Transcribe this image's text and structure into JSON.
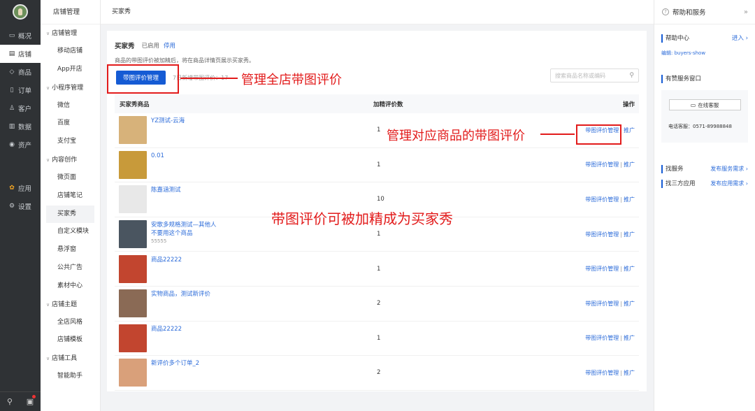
{
  "rail": {
    "items": [
      {
        "icon": "▭",
        "label": "概况"
      },
      {
        "icon": "▤",
        "label": "店铺"
      },
      {
        "icon": "◇",
        "label": "商品"
      },
      {
        "icon": "▯",
        "label": "订单"
      },
      {
        "icon": "♙",
        "label": "客户"
      },
      {
        "icon": "▥",
        "label": "数据"
      },
      {
        "icon": "◉",
        "label": "资产"
      }
    ],
    "apps": {
      "icon": "✿",
      "label": "应用"
    },
    "settings": {
      "icon": "⚙",
      "label": "设置"
    },
    "search_icon": "⚲",
    "chat_icon": "▣"
  },
  "subnav": {
    "header": "店铺管理",
    "groups": [
      {
        "label": "店铺管理",
        "items": [
          "移动店铺",
          "App开店"
        ]
      },
      {
        "label": "小程序管理",
        "items": [
          "微信",
          "百度",
          "支付宝"
        ]
      },
      {
        "label": "内容创作",
        "items": [
          "微页面",
          "店铺笔记",
          "买家秀",
          "自定义模块",
          "悬浮窗",
          "公共广告",
          "素材中心"
        ]
      },
      {
        "label": "店铺主题",
        "items": [
          "全店风格",
          "店铺模板"
        ]
      },
      {
        "label": "店铺工具",
        "items": [
          "智能助手"
        ]
      }
    ]
  },
  "topbar": {
    "title": "买家秀"
  },
  "main": {
    "title": "买家秀",
    "status": "已启用",
    "disable_label": "停用",
    "description": "商品的带图评价被加精后，将在商品详情页展示买家秀。",
    "manage_button": "带图评价管理",
    "hint": "7日新增带图评价：17",
    "search_placeholder": "搜索商品名称或编码",
    "search_icon": "⚲",
    "columns": {
      "product": "买家秀商品",
      "count": "加精评价数",
      "action": "操作"
    },
    "rows": [
      {
        "name": "YZ测试-云海",
        "sub": "",
        "count": "1",
        "thumb": "#d7b27a"
      },
      {
        "name": "0.01",
        "sub": "",
        "count": "1",
        "thumb": "#c89a3a"
      },
      {
        "name": "陈嘉涵测试",
        "sub": "",
        "count": "10",
        "thumb": "#e8e8e8"
      },
      {
        "name": "安歌多规格测试—其他人不要用这个商品",
        "sub": "55555",
        "count": "1",
        "thumb": "#4a5560"
      },
      {
        "name": "商品22222",
        "sub": "",
        "count": "1",
        "thumb": "#c2452f"
      },
      {
        "name": "实物商品，测试新评价",
        "sub": "",
        "count": "2",
        "thumb": "#8a6a55"
      },
      {
        "name": "商品22222",
        "sub": "",
        "count": "1",
        "thumb": "#c2452f"
      },
      {
        "name": "新评价多个订单_2",
        "sub": "",
        "count": "2",
        "thumb": "#d9a07a"
      }
    ],
    "action_manage": "带图评价管理",
    "action_promote": "推广",
    "action_sep": "|"
  },
  "help": {
    "title": "帮助和服务",
    "collapse_icon": "»",
    "help_center": "帮助中心",
    "enter": "进入 ›",
    "edit_label": "编辑: buyers-show",
    "service_window": "有赞服务窗口",
    "online_cs": "在线客服",
    "phone": "电话客服：0571-89988848",
    "find_service": "找服务",
    "publish_service": "发布服务需求 ›",
    "find_app": "找三方应用",
    "publish_app": "发布应用需求 ›"
  },
  "annotations": {
    "a1": "管理全店带图评价",
    "a2": "管理对应商品的带图评价",
    "a3": "带图评价可被加精成为买家秀"
  }
}
